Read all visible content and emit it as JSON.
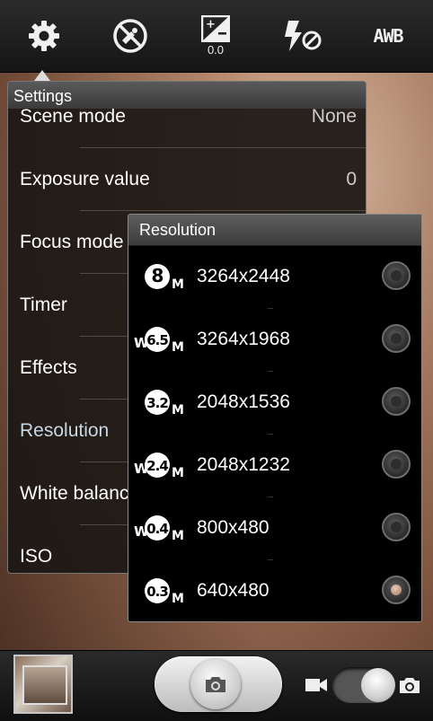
{
  "topbar": {
    "items": [
      {
        "icon": "gear-icon"
      },
      {
        "icon": "no-gps-icon"
      },
      {
        "icon": "exposure-icon",
        "value": "0.0"
      },
      {
        "icon": "flash-off-icon"
      },
      {
        "icon": "awb-icon",
        "label": "AWB"
      }
    ]
  },
  "settings": {
    "title": "Settings",
    "rows": [
      {
        "label": "Scene mode",
        "value": "None"
      },
      {
        "label": "Exposure value",
        "value": "0"
      },
      {
        "label": "Focus mode",
        "value": ""
      },
      {
        "label": "Timer",
        "value": ""
      },
      {
        "label": "Effects",
        "value": ""
      },
      {
        "label": "Resolution",
        "value": ""
      },
      {
        "label": "White balance",
        "value": ""
      },
      {
        "label": "ISO",
        "value": ""
      }
    ]
  },
  "resolution": {
    "title": "Resolution",
    "options": [
      {
        "badge": "8",
        "prefix": "",
        "label": "3264x2448",
        "selected": false
      },
      {
        "badge": "6.5",
        "prefix": "W",
        "label": "3264x1968",
        "selected": false
      },
      {
        "badge": "3.2",
        "prefix": "",
        "label": "2048x1536",
        "selected": false
      },
      {
        "badge": "2.4",
        "prefix": "W",
        "label": "2048x1232",
        "selected": false
      },
      {
        "badge": "0.4",
        "prefix": "W",
        "label": "800x480",
        "selected": false
      },
      {
        "badge": "0.3",
        "prefix": "",
        "label": "640x480",
        "selected": true
      }
    ]
  },
  "bottombar": {
    "thumbnail": "gallery-thumbnail",
    "shutter_icon": "camera-icon",
    "mode_left_icon": "video-camera-icon",
    "mode_right_icon": "camera-icon"
  },
  "colors": {
    "accent_selected": "#c9d6e4",
    "radio_selected": "#c69a86"
  }
}
